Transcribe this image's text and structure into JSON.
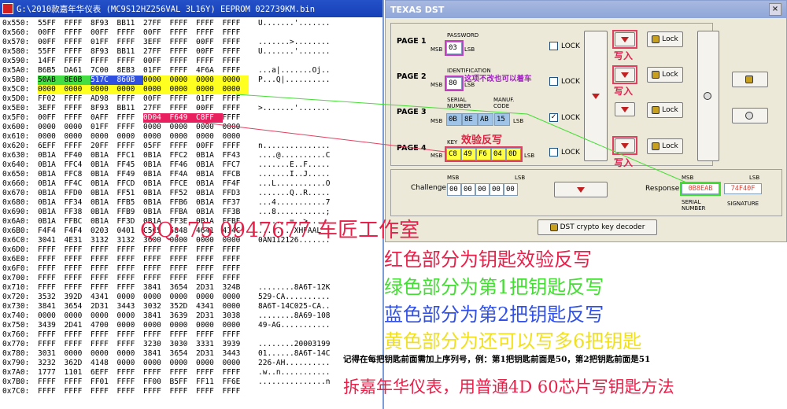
{
  "hex_window": {
    "title": "G:\\2010款嘉年华仪表 (MC9S12HZ256VAL 3L16Y) EEPROM 022739KM.bin",
    "rows": [
      {
        "addr": "0x550:",
        "cells": [
          "55FF",
          "FFFF",
          "8F93",
          "BB11",
          "27FF",
          "FFFF",
          "FFFF",
          "FFFF"
        ],
        "ascii": "U.......'......."
      },
      {
        "addr": "0x560:",
        "cells": [
          "00FF",
          "FFFF",
          "00FF",
          "FFFF",
          "00FF",
          "FFFF",
          "FFFF",
          "FFFF"
        ],
        "ascii": ""
      },
      {
        "addr": "0x570:",
        "cells": [
          "00FF",
          "FFFF",
          "01FF",
          "FFFF",
          "3EFF",
          "FFFF",
          "00FF",
          "FFFF"
        ],
        "ascii": ".......>........"
      },
      {
        "addr": "0x580:",
        "cells": [
          "55FF",
          "FFFF",
          "8F93",
          "BB11",
          "27FF",
          "FFFF",
          "00FF",
          "FFFF"
        ],
        "ascii": "U.......'......."
      },
      {
        "addr": "0x590:",
        "cells": [
          "14FF",
          "FFFF",
          "FFFF",
          "FFFF",
          "00FF",
          "FFFF",
          "FFFF",
          "FFFF"
        ],
        "ascii": ""
      },
      {
        "addr": "0x5A0:",
        "cells": [
          "B6B5",
          "DA61",
          "7C00",
          "8EB3",
          "01FF",
          "FFFF",
          "4F6A",
          "FFFF"
        ],
        "ascii": "...a|.......Oj.."
      },
      {
        "addr": "0x5B0:",
        "cells": [
          "50AB",
          "8E0B",
          "517C",
          "860B",
          "0000",
          "0000",
          "0000",
          "0000"
        ],
        "ascii": "P...Q|.........."
      },
      {
        "addr": "0x5C0:",
        "cells": [
          "0000",
          "0000",
          "0000",
          "0000",
          "0000",
          "0000",
          "0000",
          "0000"
        ],
        "ascii": ""
      },
      {
        "addr": "0x5D0:",
        "cells": [
          "FF02",
          "FFFF",
          "AD98",
          "FFFF",
          "00FF",
          "FFFF",
          "01FF",
          "FFFF"
        ],
        "ascii": ""
      },
      {
        "addr": "0x5E0:",
        "cells": [
          "3EFF",
          "FFFF",
          "8F93",
          "BB11",
          "27FF",
          "FFFF",
          "00FF",
          "FFFF"
        ],
        "ascii": ">.......'......."
      },
      {
        "addr": "0x5F0:",
        "cells": [
          "00FF",
          "FFFF",
          "0AFF",
          "FFFF",
          "0D04",
          "F649",
          "C8FF",
          "FFFF"
        ],
        "ascii": ""
      },
      {
        "addr": "0x600:",
        "cells": [
          "0000",
          "0000",
          "01FF",
          "FFFF",
          "0000",
          "0000",
          "0000",
          "0000"
        ],
        "ascii": ""
      },
      {
        "addr": "0x610:",
        "cells": [
          "0000",
          "0000",
          "0000",
          "0000",
          "0000",
          "0000",
          "0000",
          "0000"
        ],
        "ascii": ""
      },
      {
        "addr": "0x620:",
        "cells": [
          "6EFF",
          "FFFF",
          "20FF",
          "FFFF",
          "05FF",
          "FFFF",
          "00FF",
          "FFFF"
        ],
        "ascii": "n..............."
      },
      {
        "addr": "0x630:",
        "cells": [
          "0B1A",
          "FF40",
          "0B1A",
          "FFC1",
          "0B1A",
          "FFC2",
          "0B1A",
          "FF43"
        ],
        "ascii": "....@..........C"
      },
      {
        "addr": "0x640:",
        "cells": [
          "0B1A",
          "FFC4",
          "0B1A",
          "FF45",
          "0B1A",
          "FF46",
          "0B1A",
          "FFC7"
        ],
        "ascii": ".......E..F....."
      },
      {
        "addr": "0x650:",
        "cells": [
          "0B1A",
          "FFC8",
          "0B1A",
          "FF49",
          "0B1A",
          "FF4A",
          "0B1A",
          "FFCB"
        ],
        "ascii": ".......I..J....."
      },
      {
        "addr": "0x660:",
        "cells": [
          "0B1A",
          "FF4C",
          "0B1A",
          "FFCD",
          "0B1A",
          "FFCE",
          "0B1A",
          "FF4F"
        ],
        "ascii": "...L...........O"
      },
      {
        "addr": "0x670:",
        "cells": [
          "0B1A",
          "FFD0",
          "0B1A",
          "FF51",
          "0B1A",
          "FF52",
          "0B1A",
          "FFD3"
        ],
        "ascii": ".......Q..R....."
      },
      {
        "addr": "0x680:",
        "cells": [
          "0B1A",
          "FF34",
          "0B1A",
          "FFB5",
          "0B1A",
          "FFB6",
          "0B1A",
          "FF37"
        ],
        "ascii": "...4...........7"
      },
      {
        "addr": "0x690:",
        "cells": [
          "0B1A",
          "FF38",
          "0B1A",
          "FFB9",
          "0B1A",
          "FFBA",
          "0B1A",
          "FF3B"
        ],
        "ascii": "...8...........;"
      },
      {
        "addr": "0x6A0:",
        "cells": [
          "0B1A",
          "FFBC",
          "0B1A",
          "FF3D",
          "0B1A",
          "FF3E",
          "0B1A",
          "FFBF"
        ],
        "ascii": ".......=..>....."
      },
      {
        "addr": "0x6B0:",
        "cells": [
          "F4F4",
          "F4F4",
          "0203",
          "0401",
          "C5C5",
          "5848",
          "4641",
          "414C"
        ],
        "ascii": "........XHFAAL"
      },
      {
        "addr": "0x6C0:",
        "cells": [
          "3041",
          "4E31",
          "3132",
          "3132",
          "3600",
          "0000",
          "0000",
          "0000"
        ],
        "ascii": "0AN112126......."
      },
      {
        "addr": "0x6D0:",
        "cells": [
          "FFFF",
          "FFFF",
          "FFFF",
          "FFFF",
          "FFFF",
          "FFFF",
          "FFFF",
          "FFFF"
        ],
        "ascii": ""
      },
      {
        "addr": "0x6E0:",
        "cells": [
          "FFFF",
          "FFFF",
          "FFFF",
          "FFFF",
          "FFFF",
          "FFFF",
          "FFFF",
          "FFFF"
        ],
        "ascii": ""
      },
      {
        "addr": "0x6F0:",
        "cells": [
          "FFFF",
          "FFFF",
          "FFFF",
          "FFFF",
          "FFFF",
          "FFFF",
          "FFFF",
          "FFFF"
        ],
        "ascii": ""
      },
      {
        "addr": "0x700:",
        "cells": [
          "FFFF",
          "FFFF",
          "FFFF",
          "FFFF",
          "FFFF",
          "FFFF",
          "FFFF",
          "FFFF"
        ],
        "ascii": ""
      },
      {
        "addr": "0x710:",
        "cells": [
          "FFFF",
          "FFFF",
          "FFFF",
          "FFFF",
          "3841",
          "3654",
          "2D31",
          "324B"
        ],
        "ascii": "........8A6T-12K"
      },
      {
        "addr": "0x720:",
        "cells": [
          "3532",
          "392D",
          "4341",
          "0000",
          "0000",
          "0000",
          "0000",
          "0000"
        ],
        "ascii": "529-CA.........."
      },
      {
        "addr": "0x730:",
        "cells": [
          "3841",
          "3654",
          "2D31",
          "3443",
          "3032",
          "352D",
          "4341",
          "0000"
        ],
        "ascii": "8A6T-14C025-CA.."
      },
      {
        "addr": "0x740:",
        "cells": [
          "0000",
          "0000",
          "0000",
          "0000",
          "3841",
          "3639",
          "2D31",
          "3038"
        ],
        "ascii": "........8A69-108"
      },
      {
        "addr": "0x750:",
        "cells": [
          "3439",
          "2D41",
          "4700",
          "0000",
          "0000",
          "0000",
          "0000",
          "0000"
        ],
        "ascii": "49-AG..........."
      },
      {
        "addr": "0x760:",
        "cells": [
          "FFFF",
          "FFFF",
          "FFFF",
          "FFFF",
          "FFFF",
          "FFFF",
          "FFFF",
          "FFFF"
        ],
        "ascii": ""
      },
      {
        "addr": "0x770:",
        "cells": [
          "FFFF",
          "FFFF",
          "FFFF",
          "FFFF",
          "3230",
          "3030",
          "3331",
          "3939"
        ],
        "ascii": "........20003199"
      },
      {
        "addr": "0x780:",
        "cells": [
          "3031",
          "0000",
          "0000",
          "0000",
          "3841",
          "3654",
          "2D31",
          "3443"
        ],
        "ascii": "01......8A6T-14C"
      },
      {
        "addr": "0x790:",
        "cells": [
          "3232",
          "362D",
          "4148",
          "0000",
          "0000",
          "0000",
          "0000",
          "0000"
        ],
        "ascii": "226-AH.........."
      },
      {
        "addr": "0x7A0:",
        "cells": [
          "1777",
          "1101",
          "6EFF",
          "FFFF",
          "FFFF",
          "FFFF",
          "FFFF",
          "FFFF"
        ],
        "ascii": ".w..n..........."
      },
      {
        "addr": "0x7B0:",
        "cells": [
          "FFFF",
          "FFFF",
          "FF01",
          "FFFF",
          "FF00",
          "B5FF",
          "FF11",
          "FF6E"
        ],
        "ascii": "...............n"
      },
      {
        "addr": "0x7C0:",
        "cells": [
          "FFFF",
          "FFFF",
          "FFFF",
          "FFFF",
          "FFFF",
          "FFFF",
          "FFFF",
          "FFFF"
        ],
        "ascii": ""
      }
    ]
  },
  "dst": {
    "title": "TEXAS DST",
    "page1": {
      "label": "PAGE 1",
      "field_label": "PASSWORD",
      "msb": "MSB",
      "lsb": "LSB",
      "value": "03",
      "lock": "LOCK"
    },
    "page2": {
      "label": "PAGE 2",
      "field_label": "IDENTIFICATION",
      "msb": "MSB",
      "lsb": "LSB",
      "value": "80",
      "lock": "LOCK",
      "annotation": "这项不改也可以着车"
    },
    "page3": {
      "label": "PAGE 3",
      "serial_label": "SERIAL NUMBER",
      "manuf_label": "MANUF. CODE",
      "msb": "MSB",
      "lsb": "LSB",
      "values": [
        "0B",
        "8E",
        "AB",
        "15"
      ],
      "lock": "LOCK"
    },
    "page4": {
      "label": "PAGE 4",
      "field_label": "KEY",
      "msb": "MSB",
      "lsb": "LSB",
      "values": [
        "C8",
        "49",
        "F6",
        "04",
        "0D"
      ],
      "lock": "LOCK",
      "annotation": "效验反写"
    },
    "lock_btn": "Lock",
    "write_label": "写入",
    "challenge": {
      "label": "Challenge",
      "msb": "MSB",
      "lsb": "LSB",
      "values": [
        "00",
        "00",
        "00",
        "00",
        "00"
      ]
    },
    "response": {
      "label": "Response",
      "msb": "MSB",
      "lsb": "LSB",
      "serial": "0B8EAB",
      "signature": "74F40F",
      "serial_label": "SERIAL NUMBER",
      "signature_label": "SIGNATURE"
    },
    "decoder_btn": "DST crypto key decoder"
  },
  "overlay": {
    "qq": "QQ: 75 0947677 车匠工作室",
    "lines": [
      {
        "text": "红色部分为钥匙效验反写",
        "color": "#e8204a"
      },
      {
        "text": "绿色部分为第1把钥匙反写",
        "color": "#44dd33"
      },
      {
        "text": "蓝色部分为第2把钥匙反写",
        "color": "#3050e8"
      },
      {
        "text": "黄色部分为还可以写多6把钥匙",
        "color": "#f0e020"
      }
    ],
    "note": "记得在每把钥匙前面需加上序列号，例：第1把钥匙前面是50，第2把钥匙前面是51",
    "footer": "拆嘉年华仪表，用普通4D 60芯片写钥匙方法",
    "footer_color": "#e8204a"
  }
}
